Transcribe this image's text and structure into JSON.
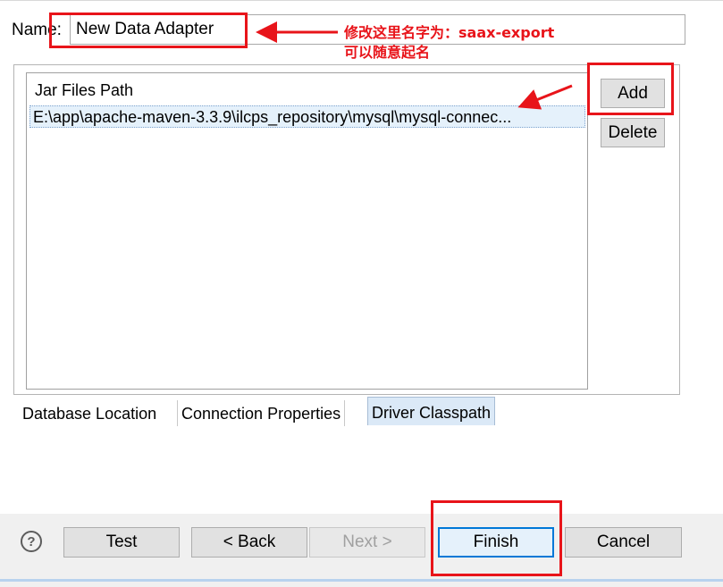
{
  "dialog": {
    "name_label": "Name:",
    "name_value": "New Data Adapter"
  },
  "annotation": {
    "line1": "修改这里名字为：saax-export",
    "line2": "可以随意起名",
    "color": "#e8141a"
  },
  "jar_list": {
    "header": "Jar Files Path",
    "rows": [
      "E:\\app\\apache-maven-3.3.9\\ilcps_repository\\mysql\\mysql-connec..."
    ]
  },
  "side_buttons": {
    "add": "Add",
    "delete": "Delete"
  },
  "tabs": [
    {
      "label": "Database Location",
      "selected": false
    },
    {
      "label": "Connection Properties",
      "selected": false
    },
    {
      "label": "Driver Classpath",
      "selected": true
    }
  ],
  "footer": {
    "help_icon": "?",
    "test": "Test",
    "back": "< Back",
    "next": "Next >",
    "finish": "Finish",
    "cancel": "Cancel"
  }
}
